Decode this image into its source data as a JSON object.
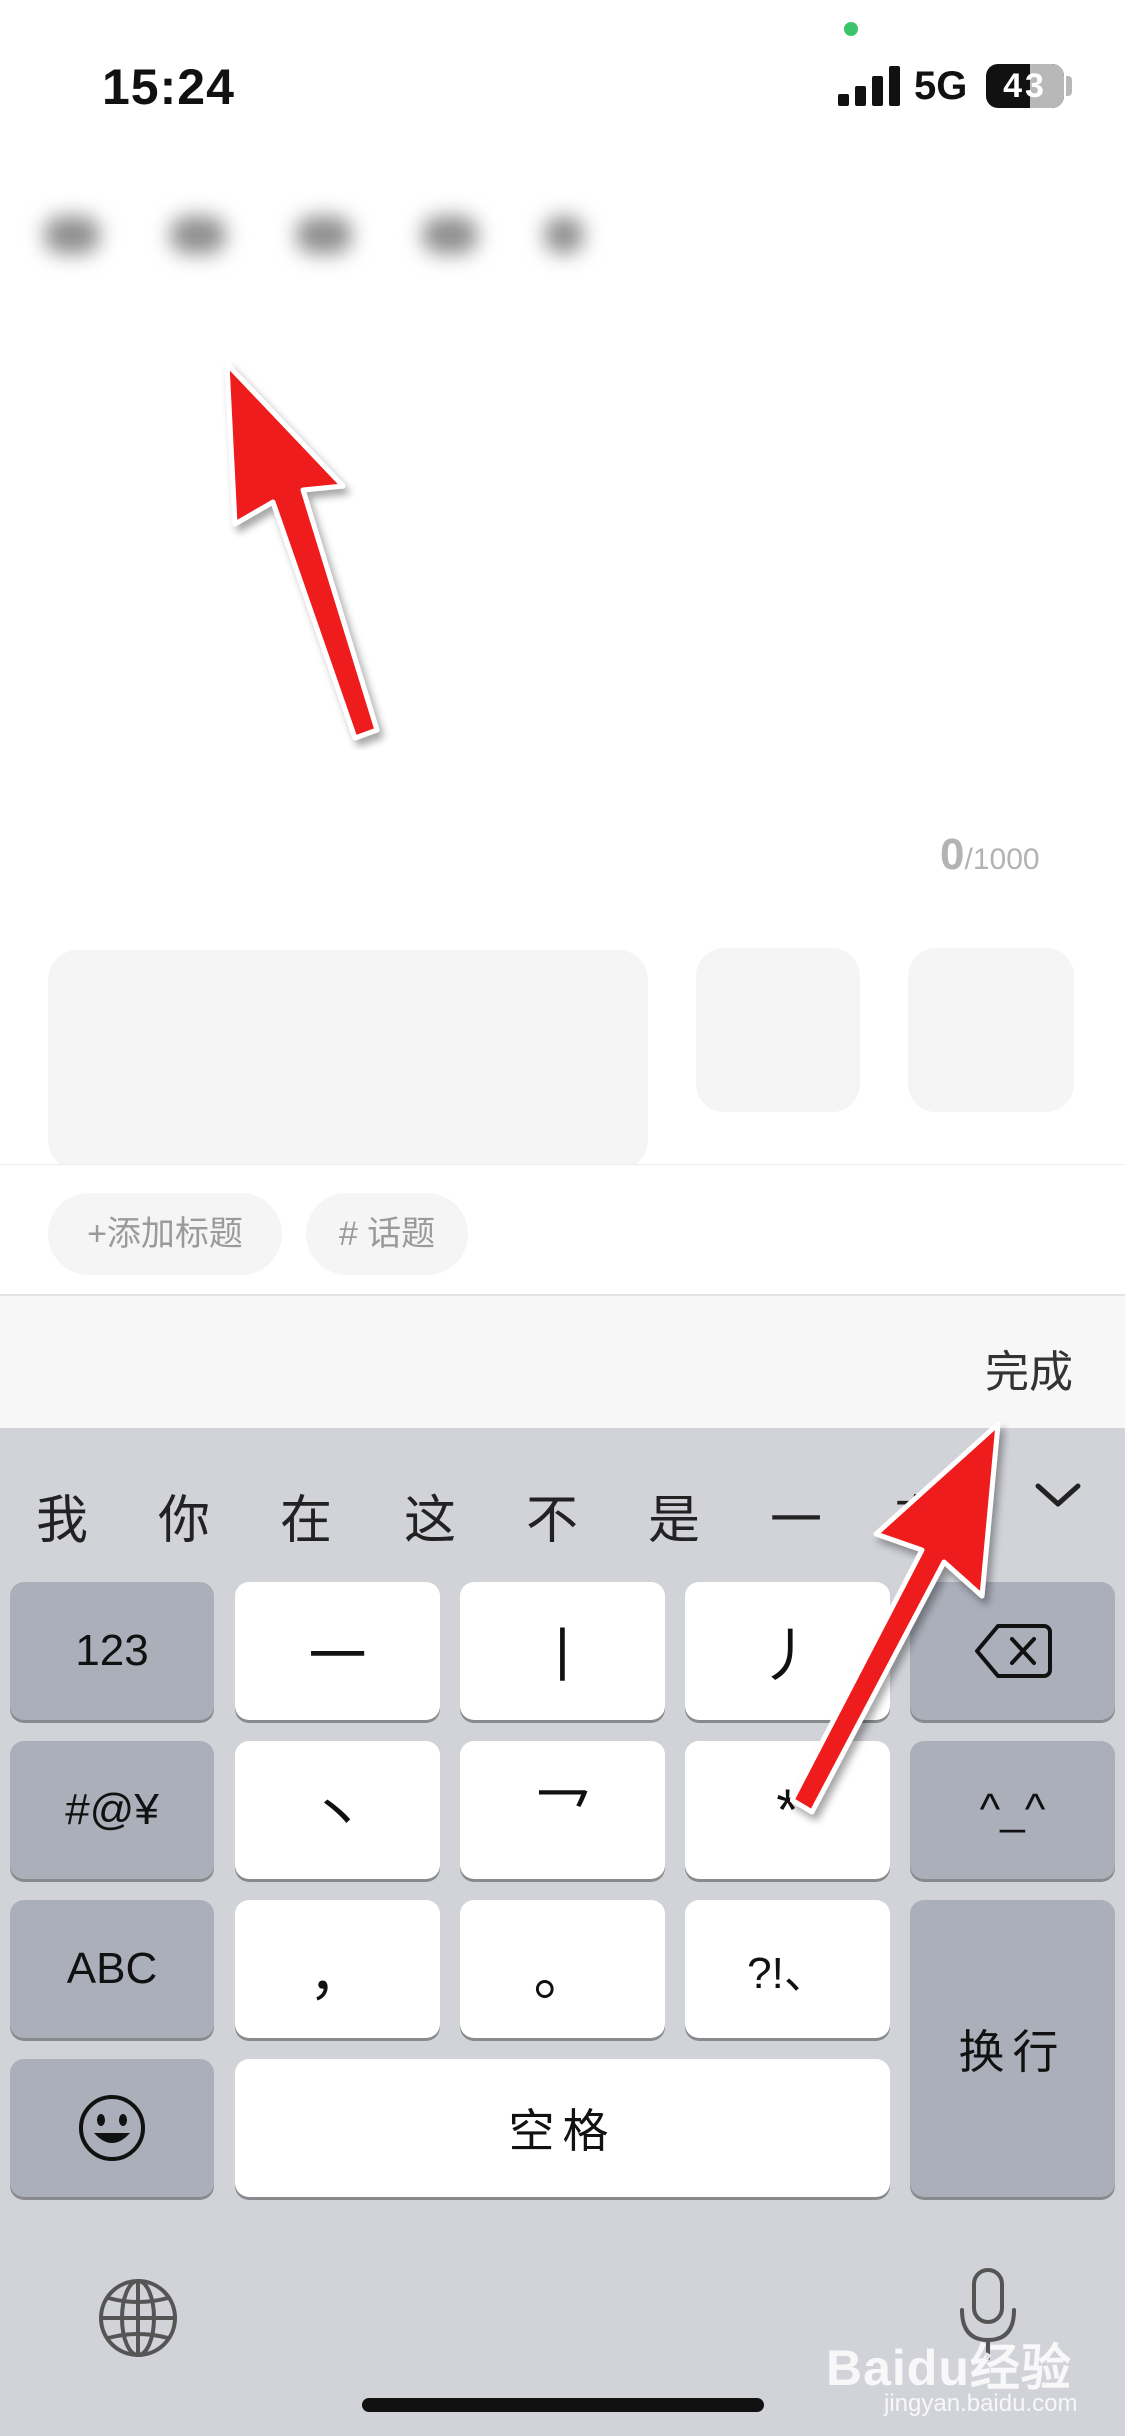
{
  "status_bar": {
    "time": "15:24",
    "network": "5G",
    "battery_level": "43"
  },
  "editor": {
    "counter_current": "0",
    "counter_max": "/1000"
  },
  "chips": {
    "add_title": "+添加标题",
    "topic": "# 话题"
  },
  "toolbar": {
    "done_label": "完成"
  },
  "keyboard": {
    "candidates": [
      "我",
      "你",
      "在",
      "这",
      "不",
      "是",
      "一",
      "有"
    ],
    "rows": {
      "numbers": "123",
      "symbols": "#@¥",
      "abc": "ABC",
      "stroke_heng": "一",
      "stroke_shu": "丨",
      "stroke_pie": "丿",
      "stroke_dian": "丶",
      "stroke_zhe": "乛",
      "wildcard": "*",
      "comma": "，",
      "period": "。",
      "punct": "?!、",
      "face": "^_^",
      "return_label": "换行",
      "space_label": "空格"
    }
  },
  "watermark": {
    "main": "Baidu经验",
    "sub": "jingyan.baidu.com"
  },
  "colors": {
    "annotation_arrow": "#ee1c1c",
    "keyboard_bg": "#d1d3d9",
    "dark_key": "#abafba"
  },
  "icons": [
    "signal-icon",
    "battery-icon",
    "backspace-icon",
    "emoji-icon",
    "globe-icon",
    "microphone-icon",
    "chevron-down-icon"
  ]
}
